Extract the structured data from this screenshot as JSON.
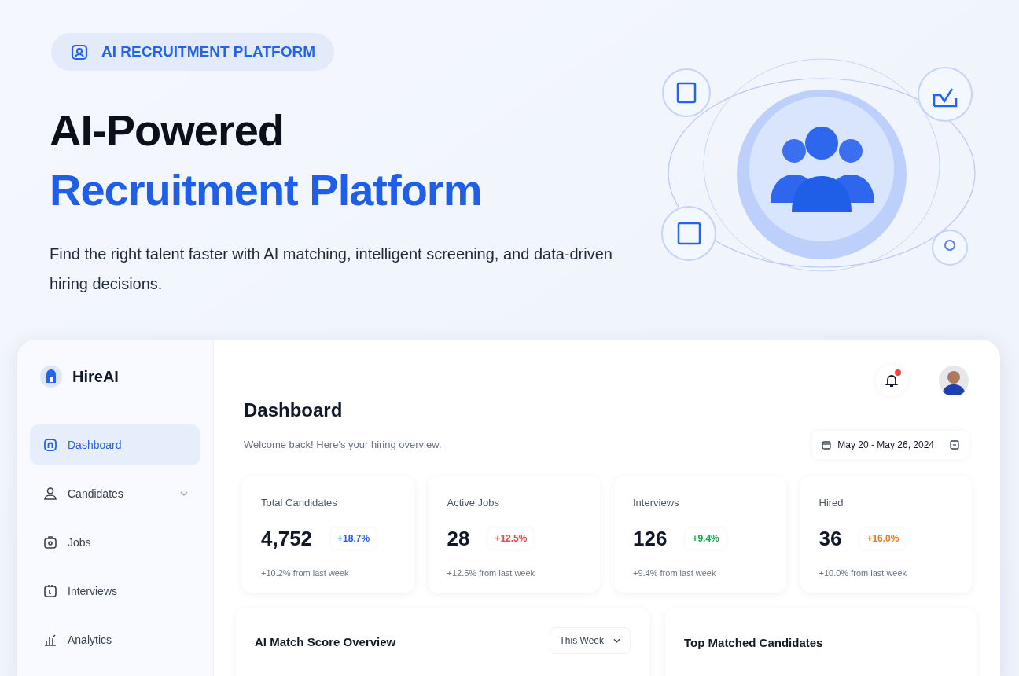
{
  "hero": {
    "badge": "AI RECRUITMENT PLATFORM",
    "title_line_1": "AI-Powered",
    "title_line_2": "Recruitment Platform",
    "subtitle": "Find the right talent faster with AI matching, intelligent screening, and data-driven hiring decisions."
  },
  "app": {
    "brand": "HireAI",
    "sidebar": {
      "items": [
        {
          "label": "Dashboard",
          "selected": true,
          "expandable": false
        },
        {
          "label": "Candidates",
          "selected": false,
          "expandable": true
        },
        {
          "label": "Jobs",
          "selected": false,
          "expandable": false
        },
        {
          "label": "Interviews",
          "selected": false,
          "expandable": false
        },
        {
          "label": "Analytics",
          "selected": false,
          "expandable": false
        }
      ]
    },
    "header": {
      "notification": true
    },
    "page": {
      "title": "Dashboard",
      "subtitle": "Welcome back! Here's your hiring overview.",
      "date_range": "May 20 - May 26, 2024"
    },
    "stats": [
      {
        "label": "Total Candidates",
        "value": "4,752",
        "badge": "+18.7%",
        "color": "#2563eb",
        "footer": "+10.2% from last week"
      },
      {
        "label": "Active Jobs",
        "value": "28",
        "badge": "+12.5%",
        "color": "#ef4444",
        "footer": "+12.5% from last week"
      },
      {
        "label": "Interviews",
        "value": "126",
        "badge": "+9.4%",
        "color": "#16a34a",
        "footer": "+9.4% from last week"
      },
      {
        "label": "Hired",
        "value": "36",
        "badge": "+16.0%",
        "color": "#f97316",
        "footer": "+10.0% from last week"
      }
    ],
    "chart_card": {
      "title": "AI Match Score Overview",
      "period": "This Week"
    },
    "top_card": {
      "title": "Top Matched Candidates"
    }
  }
}
